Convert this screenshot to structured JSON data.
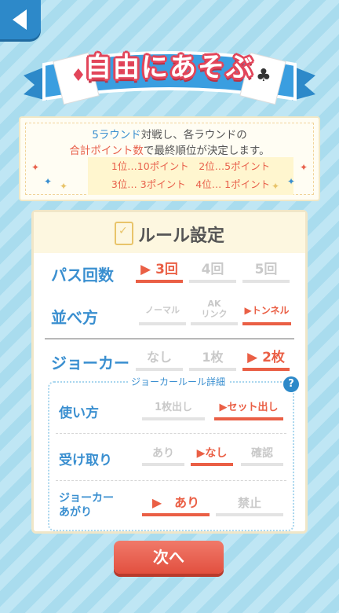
{
  "back": {
    "icon": "back-arrow-icon"
  },
  "banner": {
    "title": "自由にあそぶ"
  },
  "info": {
    "line1": [
      "5ラウンド",
      "対戦し、各ラウンドの"
    ],
    "line2": [
      "合計ポイント数",
      "で最終順位が決定します。"
    ],
    "ranks": [
      "1位…10ポイント　2位…5ポイント",
      "3位… 3ポイント　4位… 1ポイント"
    ]
  },
  "panel": {
    "title": "ルール設定",
    "pass": {
      "label": "パス回数",
      "options": [
        "▶ 3回",
        "4回",
        "5回"
      ],
      "selected": 0
    },
    "arrange": {
      "label": "並べ方",
      "options": [
        "ノーマル",
        "AK\nリンク",
        "▶トンネル"
      ],
      "selected": 2
    },
    "joker": {
      "label": "ジョーカー",
      "options": [
        "なし",
        "1枚",
        "▶ 2枚"
      ],
      "selected": 2
    },
    "detail_title": "ジョーカールール詳細",
    "help": "?",
    "usage": {
      "label": "使い方",
      "options": [
        "1枚出し",
        "▶セット出し"
      ],
      "selected": 1
    },
    "receive": {
      "label": "受け取り",
      "options": [
        "あり",
        "▶なし",
        "確認"
      ],
      "selected": 1
    },
    "finish": {
      "label1": "ジョーカー",
      "label2": "あがり",
      "options": [
        "▶　あり",
        "禁止"
      ],
      "selected": 0
    }
  },
  "next_button": "次へ",
  "colors": {
    "accent": "#ea5f45",
    "blue": "#3a8fd0",
    "banner_red": "#e2455a"
  }
}
